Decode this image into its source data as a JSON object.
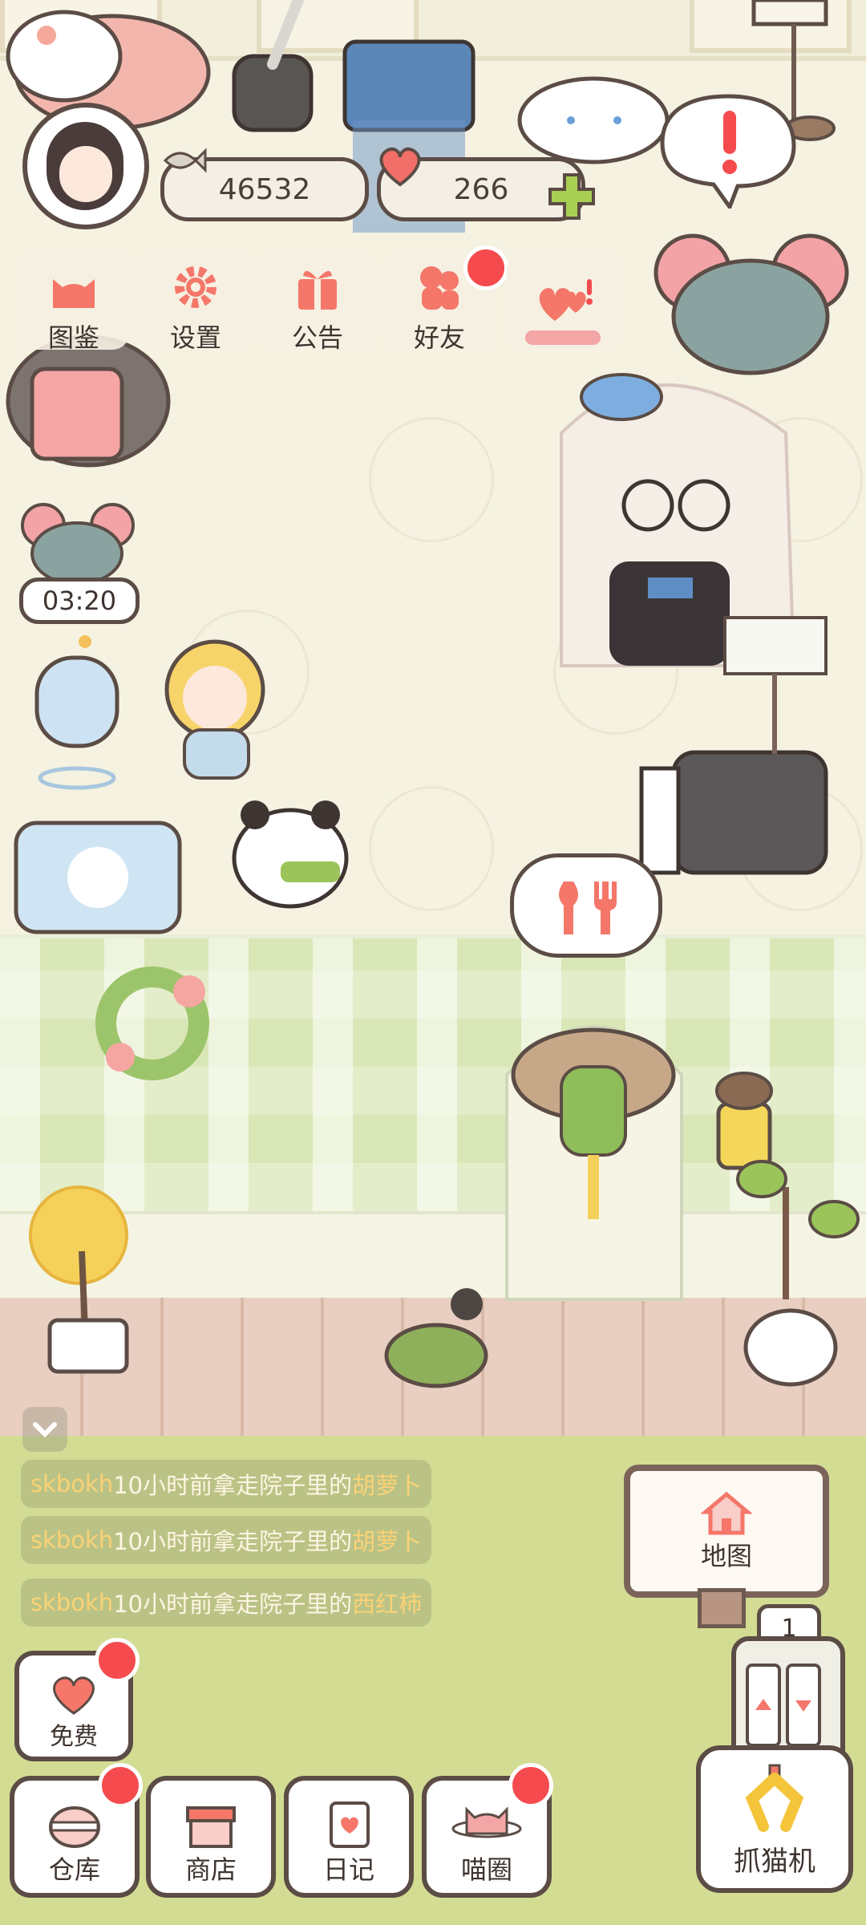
{
  "hud": {
    "coins": "46532",
    "gems": "266"
  },
  "menu": [
    {
      "label": "图鉴",
      "icon": "cat-face-icon"
    },
    {
      "label": "设置",
      "icon": "gear-icon"
    },
    {
      "label": "公告",
      "icon": "gift-icon"
    },
    {
      "label": "好友",
      "icon": "friends-icon"
    }
  ],
  "timer": "03:20",
  "messages": [
    {
      "user": "skbokh",
      "text": "10小时前拿走院子里的",
      "item": "胡萝卜"
    },
    {
      "user": "skbokh",
      "text": "10小时前拿走院子里的",
      "item": "胡萝卜"
    },
    {
      "user": "skbokh",
      "text": "10小时前拿走院子里的",
      "item": "西红柿"
    }
  ],
  "map": {
    "label": "地图"
  },
  "floor": "1",
  "claw": {
    "label": "抓猫机"
  },
  "free": {
    "label": "免费"
  },
  "bottom_nav": [
    {
      "label": "仓库",
      "icon": "storage-icon"
    },
    {
      "label": "商店",
      "icon": "shop-icon"
    },
    {
      "label": "日记",
      "icon": "diary-icon"
    },
    {
      "label": "喵圈",
      "icon": "cat-planet-icon"
    }
  ],
  "colors": {
    "accent": "#f4776a",
    "badge": "#f54b4e",
    "outline": "#5b4c45",
    "wall_green": "#d9e6b6",
    "lawn": "#d3dc93"
  }
}
